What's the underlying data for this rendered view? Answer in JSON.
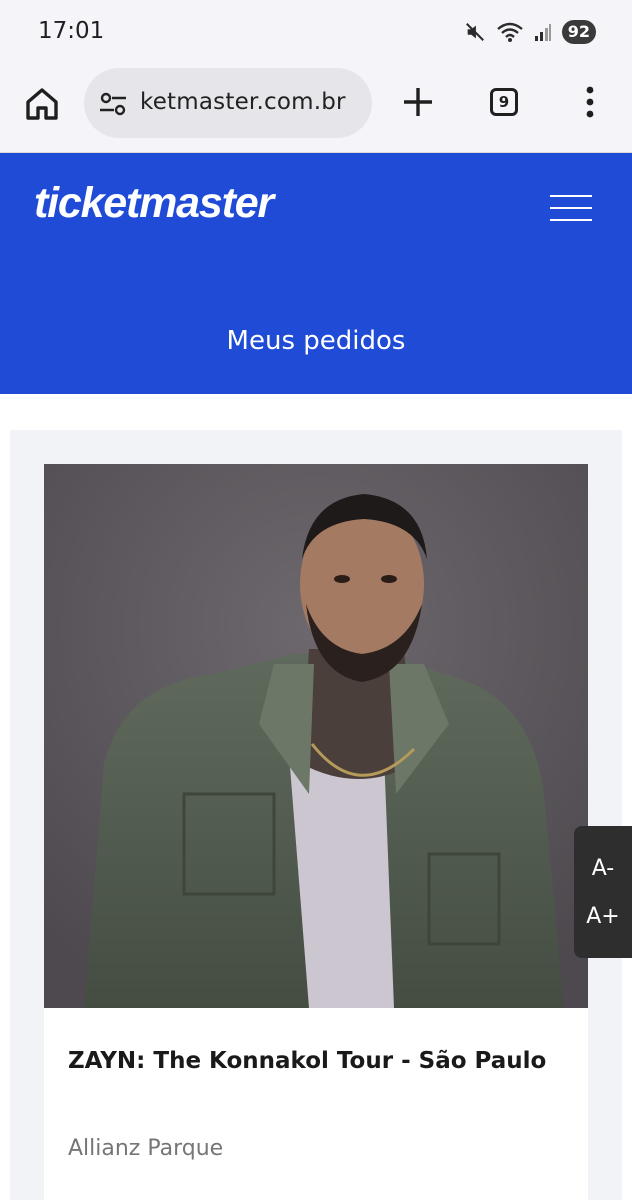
{
  "status_bar": {
    "time": "17:01",
    "icons": [
      "mute-icon",
      "wifi-icon",
      "signal-icon"
    ],
    "battery": "92"
  },
  "browser": {
    "url": "ketmaster.com.br",
    "tab_count": "9",
    "icons": [
      "home-icon",
      "site-settings-icon",
      "plus-icon",
      "tabs-icon",
      "more-vert-icon"
    ]
  },
  "header": {
    "logo": "ticketmaster",
    "section_title": "Meus pedidos",
    "brand_color": "#1f4bd6"
  },
  "order": {
    "event_title": "ZAYN: The Konnakol Tour - São Paulo",
    "venue": "Allianz Parque"
  },
  "font_controls": {
    "decrease": "A-",
    "increase": "A+"
  }
}
